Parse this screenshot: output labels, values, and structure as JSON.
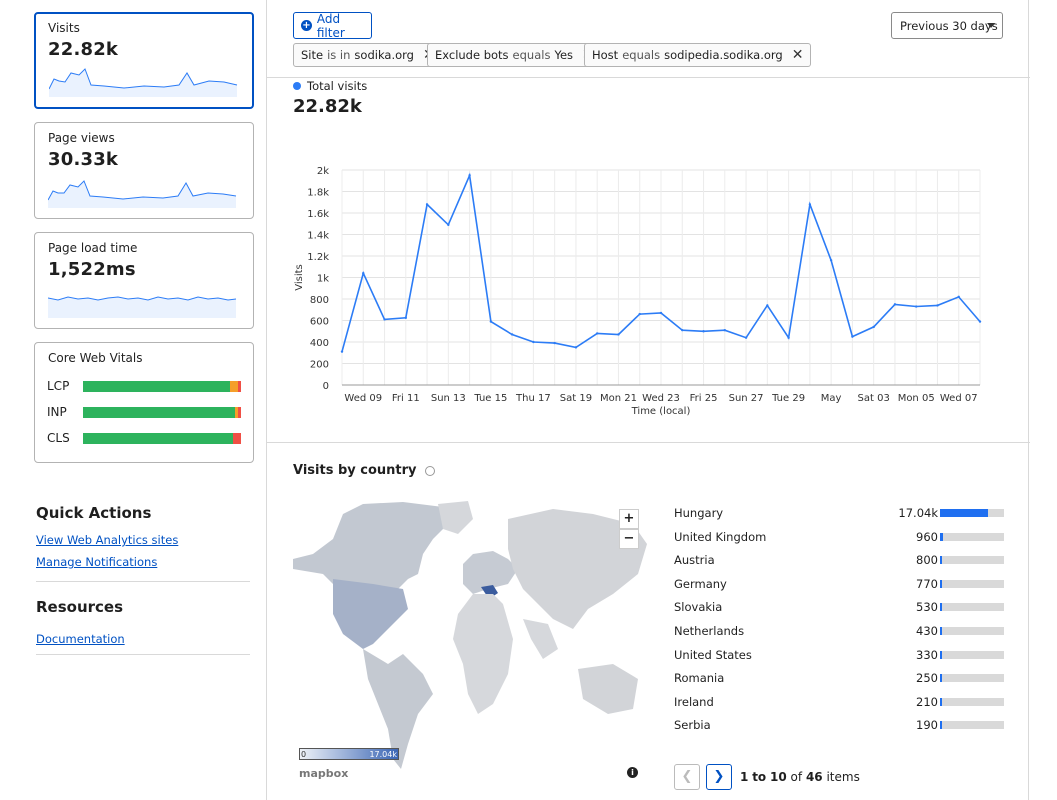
{
  "sidebar": {
    "cards": [
      {
        "label": "Visits",
        "value": "22.82k"
      },
      {
        "label": "Page views",
        "value": "30.33k"
      },
      {
        "label": "Page load time",
        "value": "1,522ms"
      }
    ],
    "cwv": {
      "title": "Core Web Vitals",
      "rows": [
        {
          "name": "LCP",
          "good": 0.93,
          "needs_improvement": 0.05,
          "poor": 0.02
        },
        {
          "name": "INP",
          "good": 0.96,
          "needs_improvement": 0.02,
          "poor": 0.02
        },
        {
          "name": "CLS",
          "good": 0.95,
          "needs_improvement": 0.0,
          "poor": 0.05
        }
      ],
      "colors": {
        "good": "#2db35d",
        "needs_improvement": "#f59f2a",
        "poor": "#f04f45"
      }
    },
    "quick_actions": {
      "title": "Quick Actions",
      "links": [
        "View Web Analytics sites",
        "Manage Notifications"
      ]
    },
    "resources": {
      "title": "Resources",
      "links": [
        "Documentation"
      ]
    }
  },
  "toolbar": {
    "add_filter": "Add filter",
    "date_range": "Previous 30 days",
    "filters": [
      {
        "field": "Site",
        "op": "is in",
        "value": "sodika.org"
      },
      {
        "field": "Exclude bots",
        "op": "equals",
        "value": "Yes"
      },
      {
        "field": "Host",
        "op": "equals",
        "value": "sodipedia.sodika.org"
      }
    ]
  },
  "summary": {
    "series_label": "Total visits",
    "total": "22.82k"
  },
  "chart_data": {
    "type": "line",
    "xlabel": "Time (local)",
    "ylabel": "Visits",
    "ylim": [
      0,
      2000
    ],
    "yticks": [
      0,
      200,
      400,
      600,
      800,
      1000,
      1200,
      1400,
      1600,
      1800,
      2000
    ],
    "ytick_labels": [
      "0",
      "200",
      "400",
      "600",
      "800",
      "1k",
      "1.2k",
      "1.4k",
      "1.6k",
      "1.8k",
      "2k"
    ],
    "xtick_labels": [
      "Wed 09",
      "Fri 11",
      "Sun 13",
      "Tue 15",
      "Thu 17",
      "Sat 19",
      "Mon 21",
      "Wed 23",
      "Fri 25",
      "Sun 27",
      "Tue 29",
      "May",
      "Sat 03",
      "Mon 05",
      "Wed 07"
    ],
    "grid": true,
    "color": "#2c7cf6",
    "series": [
      {
        "values": [
          310,
          1040,
          610,
          625,
          1680,
          1490,
          1950,
          590,
          470,
          400,
          390,
          350,
          480,
          470,
          660,
          670,
          510,
          500,
          510,
          440,
          740,
          440,
          1680,
          1160,
          450,
          540,
          750,
          730,
          740,
          820,
          590
        ]
      }
    ]
  },
  "country": {
    "title": "Visits by country",
    "legend_min": "0",
    "legend_max": "17.04k",
    "attribution": "mapbox",
    "rows": [
      {
        "name": "Hungary",
        "label": "17.04k",
        "value": 17040
      },
      {
        "name": "United Kingdom",
        "label": "960",
        "value": 960
      },
      {
        "name": "Austria",
        "label": "800",
        "value": 800
      },
      {
        "name": "Germany",
        "label": "770",
        "value": 770
      },
      {
        "name": "Slovakia",
        "label": "530",
        "value": 530
      },
      {
        "name": "Netherlands",
        "label": "430",
        "value": 430
      },
      {
        "name": "United States",
        "label": "330",
        "value": 330
      },
      {
        "name": "Romania",
        "label": "250",
        "value": 250
      },
      {
        "name": "Ireland",
        "label": "210",
        "value": 210
      },
      {
        "name": "Serbia",
        "label": "190",
        "value": 190
      }
    ],
    "pager": {
      "from": "1",
      "to_label": "to",
      "to": "10",
      "of_label": "of",
      "total": "46",
      "suffix": "items"
    }
  }
}
